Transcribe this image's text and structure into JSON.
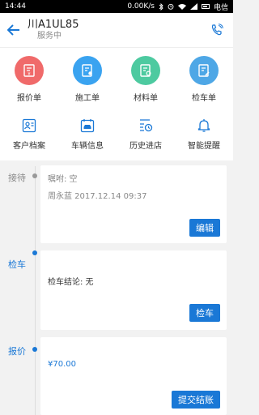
{
  "status_bar": {
    "time": "14:44",
    "speed": "0.00K/s",
    "carrier": "电信"
  },
  "header": {
    "plate": "川A1UL85",
    "status": "服务中"
  },
  "actions_row1": [
    {
      "label": "报价单",
      "icon": "quote-icon",
      "color": "#f06a6a"
    },
    {
      "label": "施工单",
      "icon": "construction-icon",
      "color": "#3aa3f0"
    },
    {
      "label": "材料单",
      "icon": "materials-icon",
      "color": "#4dcaa0"
    },
    {
      "label": "检车单",
      "icon": "inspection-icon",
      "color": "#4ea7e6"
    }
  ],
  "actions_row2": [
    {
      "label": "客户档案",
      "icon": "customer-file-icon"
    },
    {
      "label": "车辆信息",
      "icon": "vehicle-info-icon"
    },
    {
      "label": "历史进店",
      "icon": "history-icon"
    },
    {
      "label": "智能提醒",
      "icon": "bell-icon"
    }
  ],
  "timeline": {
    "reception": {
      "label": "接待",
      "note": "嘱咐: 空",
      "staff_time": "周永蓝  2017.12.14 09:37",
      "button": "编辑"
    },
    "inspection": {
      "label": "检车",
      "conclusion": "检车结论: 无",
      "button": "检车"
    },
    "quote": {
      "label": "报价",
      "amount": "¥70.00",
      "button": "提交结账"
    }
  },
  "colors": {
    "accent": "#1a78d6",
    "done": "#999999"
  }
}
